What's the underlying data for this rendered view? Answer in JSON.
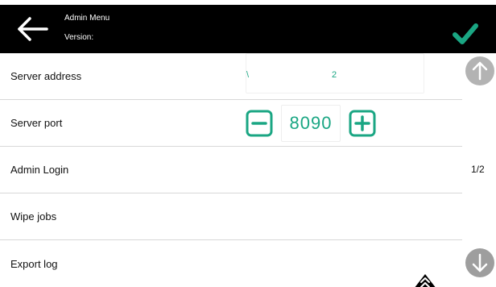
{
  "header": {
    "title": "Admin Menu",
    "version_label": "Version:"
  },
  "rows": [
    {
      "label": "Server address"
    },
    {
      "label": "Server port"
    },
    {
      "label": "Admin Login"
    },
    {
      "label": "Wipe jobs"
    },
    {
      "label": "Export log"
    }
  ],
  "server_address": {
    "part1": "\\",
    "part2": "2"
  },
  "server_port": {
    "value": "8090"
  },
  "pagination": {
    "indicator": "1/2"
  },
  "colors": {
    "header_bg": "#000000",
    "accent": "#1aa683",
    "scroll_button": "#b3b3b3",
    "divider": "#d8d8d8"
  },
  "icons": {
    "back": "arrow-left-icon",
    "confirm": "checkmark-icon",
    "minus": "minus-square-icon",
    "plus": "plus-square-icon",
    "scroll_up": "arrow-up-circle-icon",
    "scroll_down": "arrow-down-circle-icon",
    "expand": "double-chevron-up-icon"
  }
}
